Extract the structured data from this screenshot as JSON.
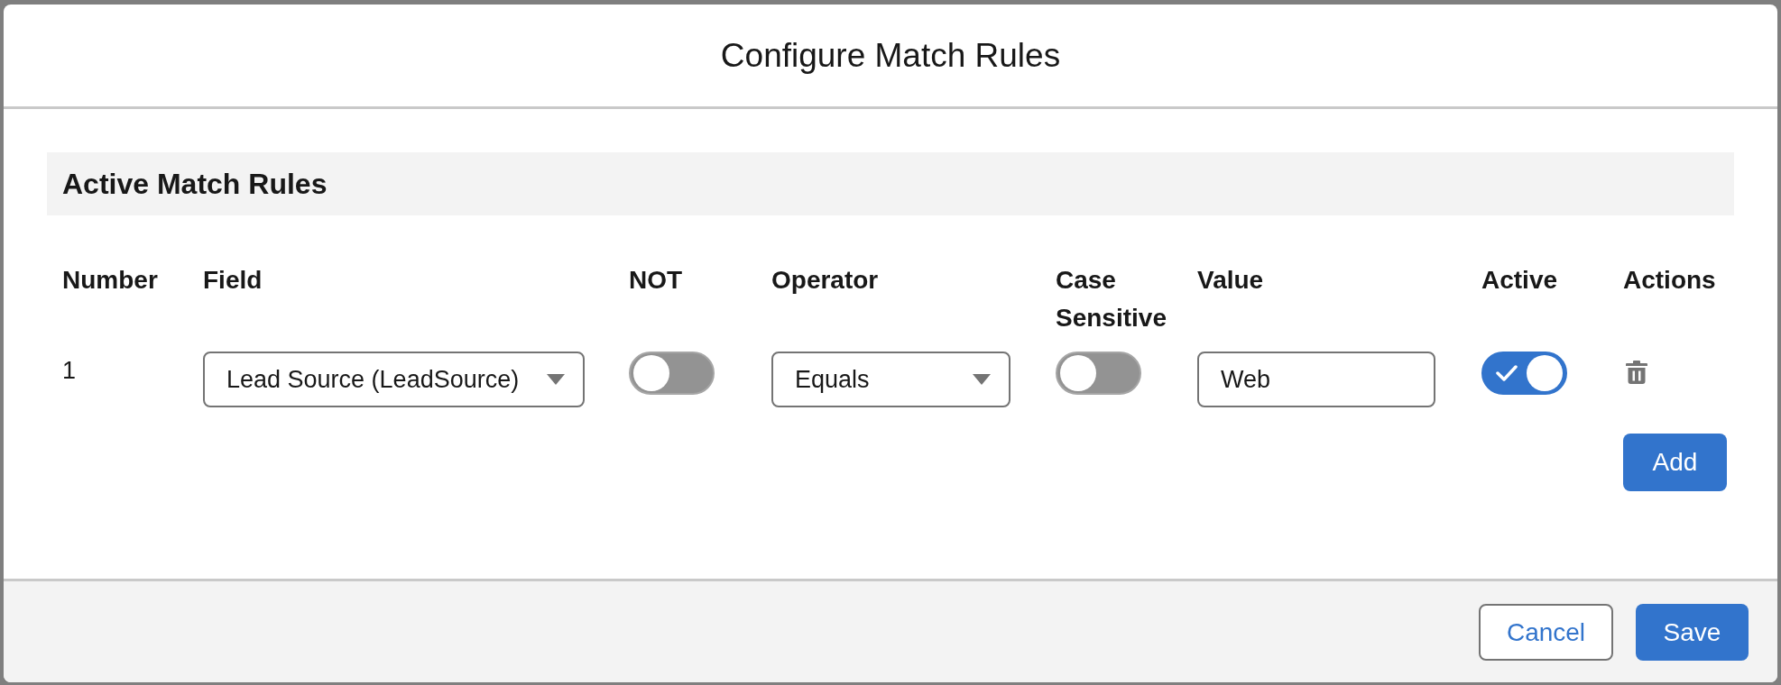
{
  "modal": {
    "title": "Configure Match Rules"
  },
  "section": {
    "title": "Active Match Rules"
  },
  "table": {
    "columns": [
      "Number",
      "Field",
      "NOT",
      "Operator",
      "Case Sensitive",
      "Value",
      "Active",
      "Actions"
    ],
    "rows": [
      {
        "number": "1",
        "field": "Lead Source (LeadSource)",
        "not": false,
        "operator": "Equals",
        "case_sensitive": false,
        "value": "Web",
        "active": true
      }
    ]
  },
  "add_button": {
    "label": "Add"
  },
  "footer": {
    "buttons": [
      {
        "label": "Cancel",
        "kind": "neutral"
      },
      {
        "label": "Save",
        "kind": "brand"
      }
    ]
  }
}
